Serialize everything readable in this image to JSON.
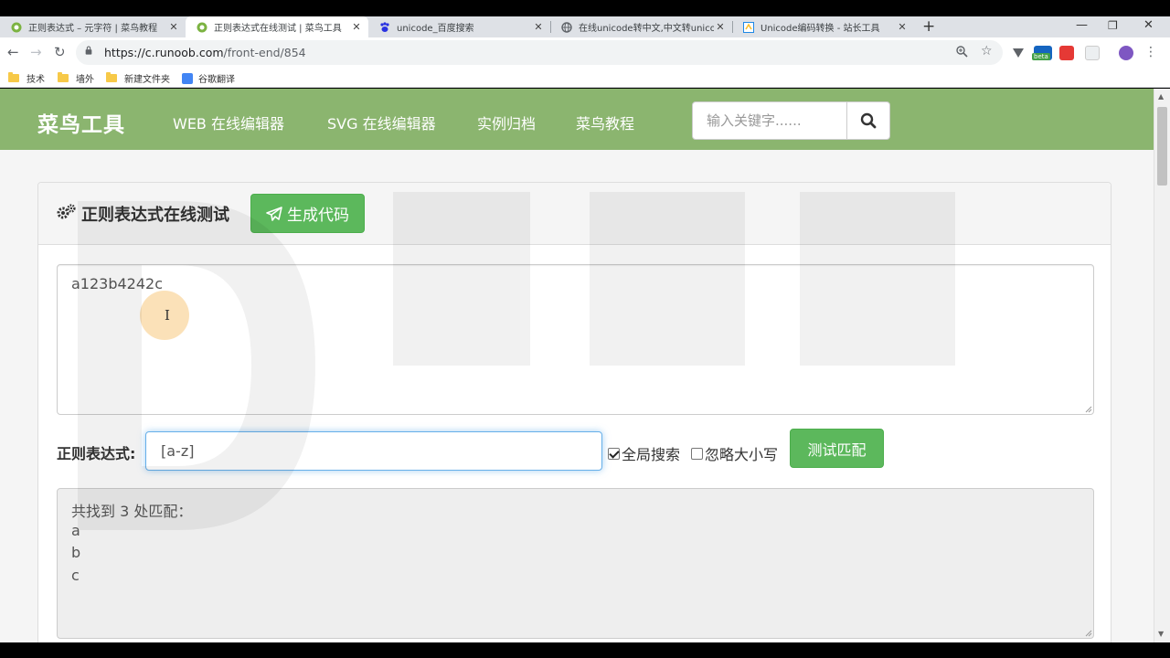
{
  "browser": {
    "tabs": [
      {
        "title": "正则表达式 – 元字符 | 菜鸟教程",
        "icon": "runoob-favicon",
        "active": false
      },
      {
        "title": "正则表达式在线测试 | 菜鸟工具",
        "icon": "runoob-favicon",
        "active": true
      },
      {
        "title": "unicode_百度搜索",
        "icon": "baidu-paw-favicon",
        "active": false
      },
      {
        "title": "在线unicode转中文,中文转unicode",
        "icon": "globe-favicon",
        "active": false
      },
      {
        "title": "Unicode编码转换 - 站长工具",
        "icon": "chinaz-favicon",
        "active": false
      }
    ],
    "url_host": "https://c.runoob.com",
    "url_path": "/front-end/854",
    "bookmarks": [
      "技术",
      "墙外",
      "新建文件夹",
      "谷歌翻译"
    ],
    "ext_badge": "beta"
  },
  "site": {
    "brand": "菜鸟工具",
    "nav": [
      "WEB 在线编辑器",
      "SVG 在线编辑器",
      "实例归档",
      "菜鸟教程"
    ],
    "search_placeholder": "输入关键字......",
    "accent": "#8bb56f"
  },
  "panel": {
    "title": "正则表达式在线测试",
    "generate_button": "生成代码",
    "source_text": "a123b4242c",
    "regex_label": "正则表达式:",
    "regex_value": "[a-z]",
    "global_label": "全局搜索",
    "global_checked": true,
    "ignorecase_label": "忽略大小写",
    "ignorecase_checked": false,
    "test_button": "测试匹配",
    "result_header": "共找到 3 处匹配：",
    "matches": [
      "a",
      "b",
      "c"
    ]
  }
}
